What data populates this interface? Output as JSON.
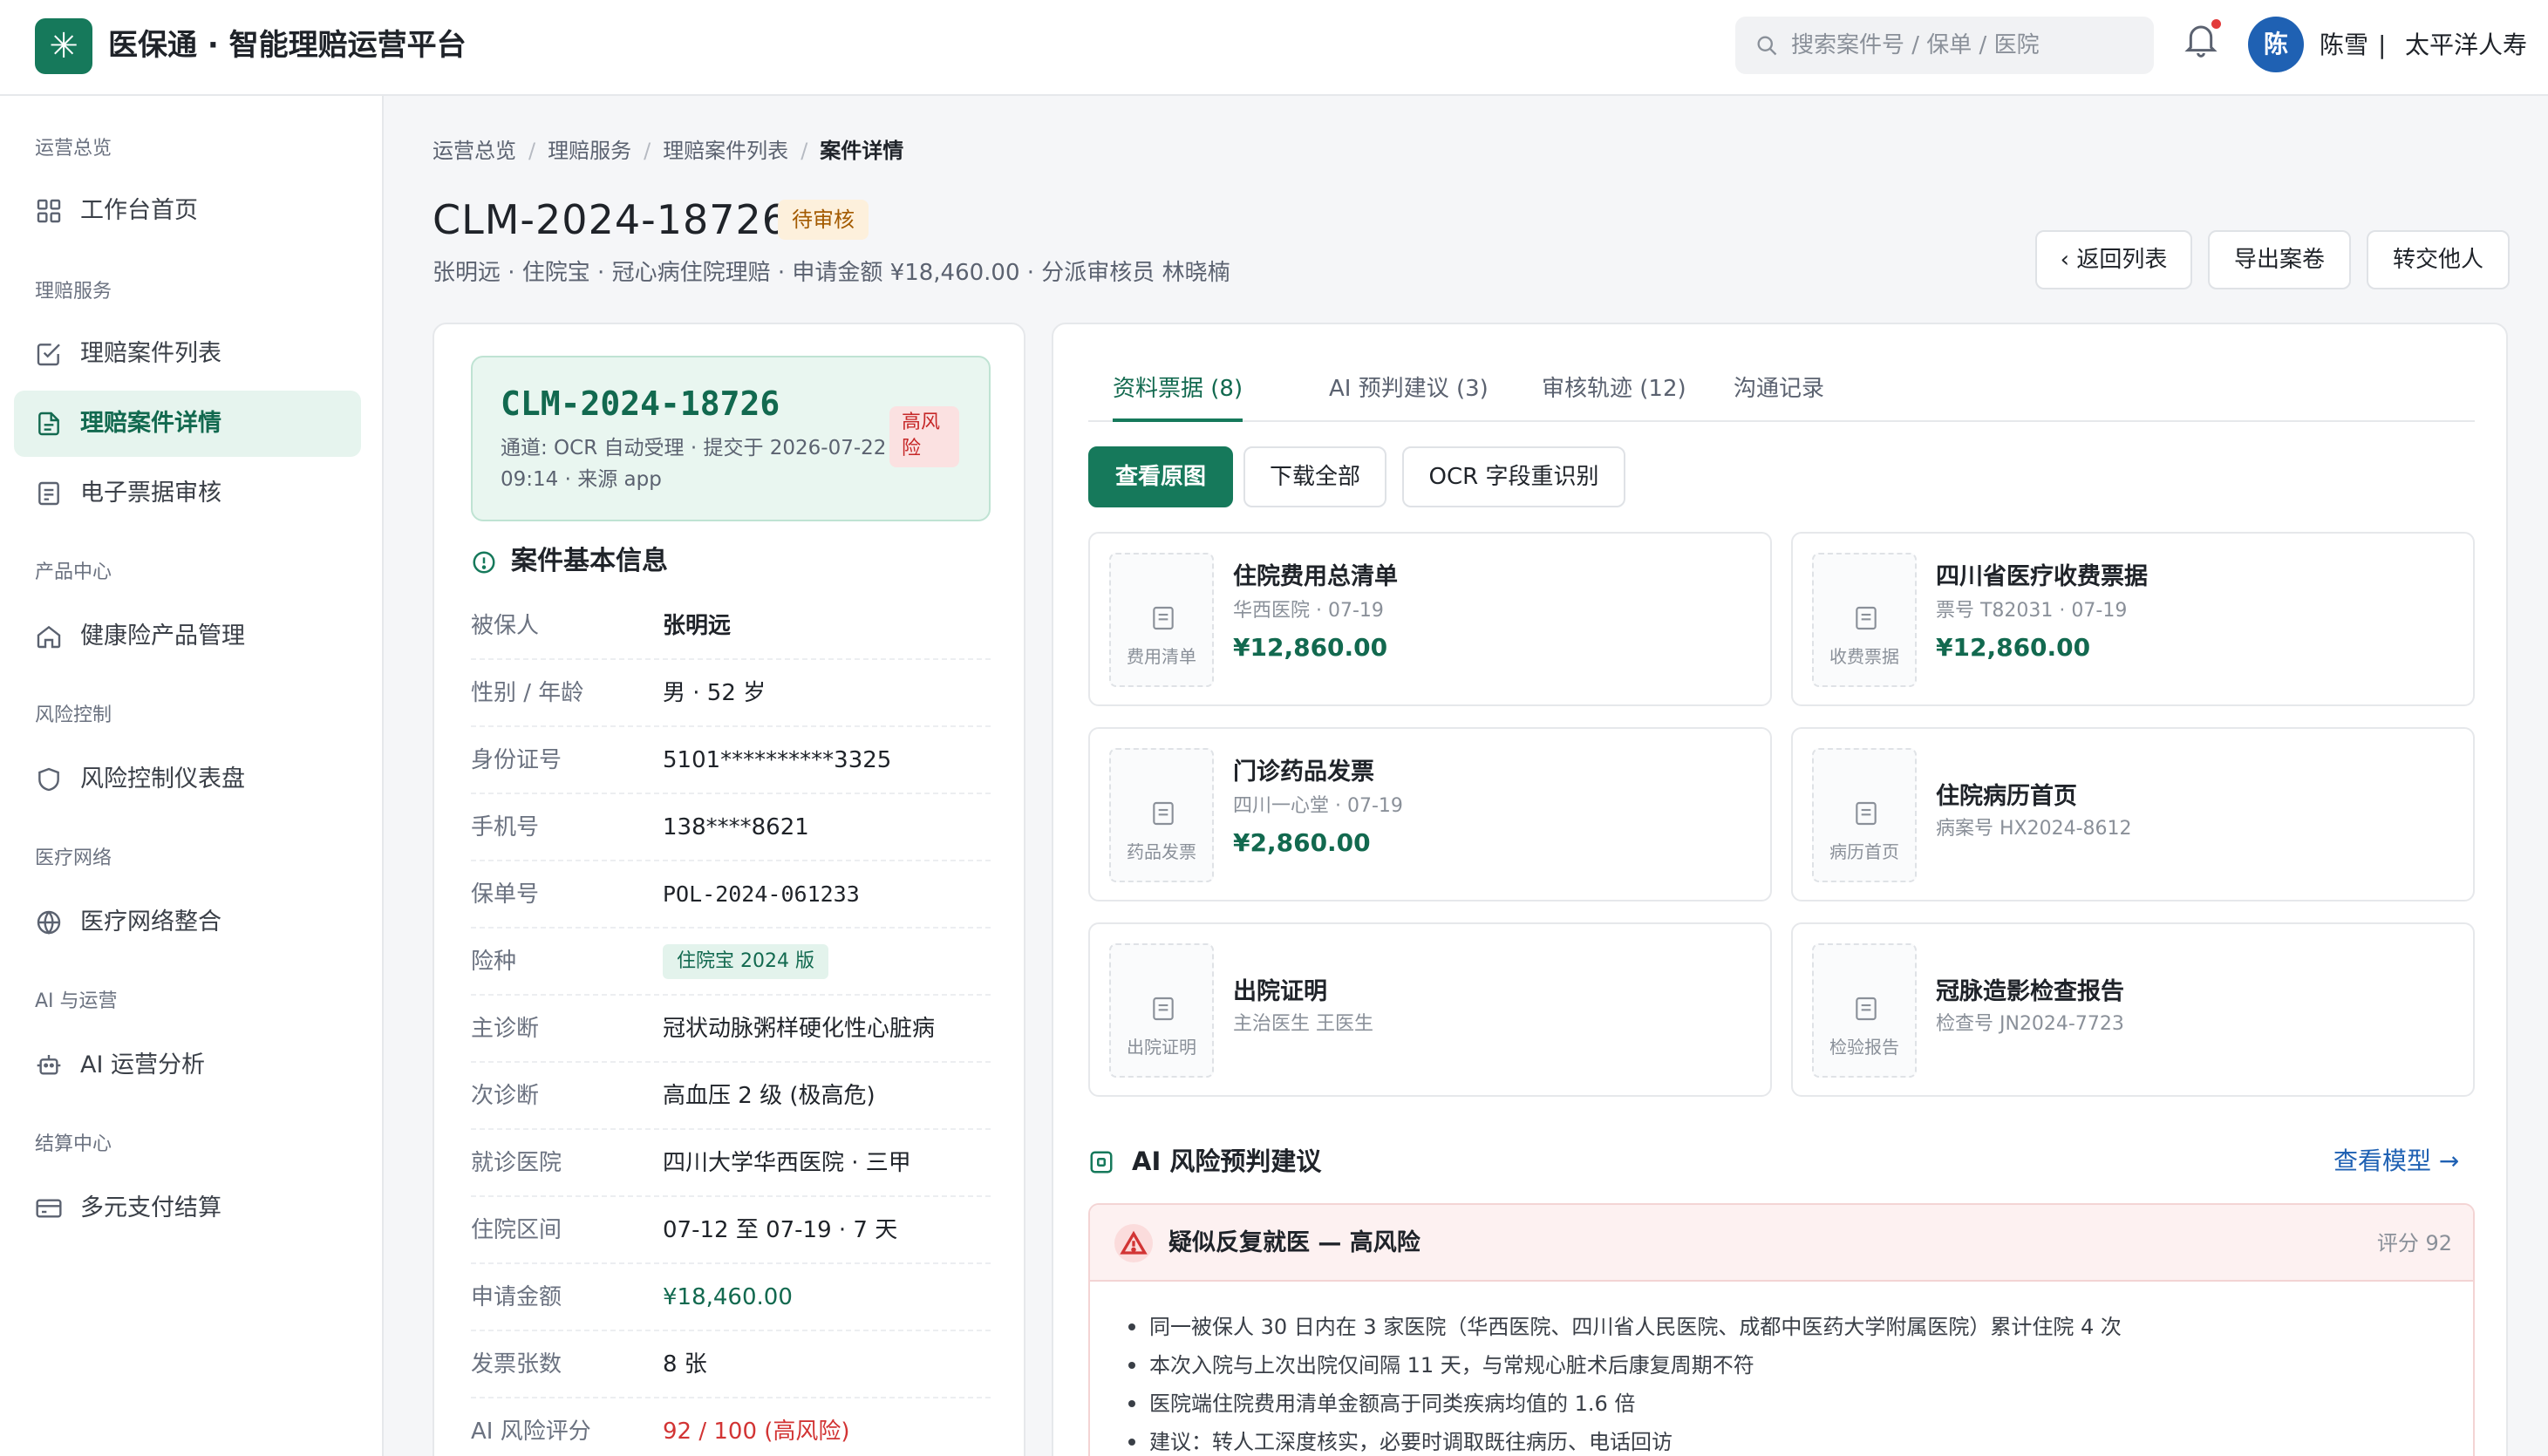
{
  "app": {
    "logo_glyph": "✳",
    "title": "医保通 · 智能理赔运营平台"
  },
  "header": {
    "search_placeholder": "搜索案件号 / 保单 / 医院",
    "avatar_initial": "陈",
    "user_name": "陈雪",
    "separator": "|",
    "org_name": "太平洋人寿"
  },
  "sidebar": {
    "groups": [
      {
        "title": "运营总览",
        "items": [
          {
            "label": "工作台首页",
            "icon": "dashboard-icon"
          }
        ]
      },
      {
        "title": "理赔服务",
        "items": [
          {
            "label": "理赔案件列表",
            "icon": "checklist-icon"
          },
          {
            "label": "理赔案件详情",
            "icon": "document-icon",
            "active": true
          },
          {
            "label": "电子票据审核",
            "icon": "receipt-icon"
          }
        ]
      },
      {
        "title": "产品中心",
        "items": [
          {
            "label": "健康险产品管理",
            "icon": "home-icon"
          }
        ]
      },
      {
        "title": "风险控制",
        "items": [
          {
            "label": "风险控制仪表盘",
            "icon": "shield-icon"
          }
        ]
      },
      {
        "title": "医疗网络",
        "items": [
          {
            "label": "医疗网络整合",
            "icon": "globe-icon"
          }
        ]
      },
      {
        "title": "AI 与运营",
        "items": [
          {
            "label": "AI 运营分析",
            "icon": "robot-icon"
          }
        ]
      },
      {
        "title": "结算中心",
        "items": [
          {
            "label": "多元支付结算",
            "icon": "card-icon"
          }
        ]
      }
    ]
  },
  "breadcrumb": [
    "运营总览",
    "理赔服务",
    "理赔案件列表",
    "案件详情"
  ],
  "breadcrumb_sep": "/",
  "case": {
    "id": "CLM-2024-18726",
    "status": "待审核",
    "subtitle": "张明远 · 住院宝 · 冠心病住院理赔 · 申请金额 ¥18,460.00 · 分派审核员 林晓楠",
    "actions": {
      "back": "‹ 返回列表",
      "export": "导出案卷",
      "transfer": "转交他人"
    }
  },
  "case_box": {
    "id": "CLM-2024-18726",
    "meta": "通道: OCR 自动受理 · 提交于 2026-07-22 09:14 · 来源 app",
    "risk": "高风险"
  },
  "basic_info": {
    "title": "案件基本信息",
    "rows": [
      {
        "key": "被保人",
        "value": "张明远"
      },
      {
        "key": "性别 / 年龄",
        "value": "男 · 52 岁"
      },
      {
        "key": "身份证号",
        "value": "5101**********3325"
      },
      {
        "key": "手机号",
        "value": "138****8621"
      },
      {
        "key": "保单号",
        "value": "POL-2024-061233"
      },
      {
        "key": "险种",
        "value": "住院宝 2024 版"
      },
      {
        "key": "主诊断",
        "value": "冠状动脉粥样硬化性心脏病"
      },
      {
        "key": "次诊断",
        "value": "高血压 2 级 (极高危)"
      },
      {
        "key": "就诊医院",
        "value": "四川大学华西医院 · 三甲"
      },
      {
        "key": "住院区间",
        "value": "07-12 至 07-19 · 7 天"
      },
      {
        "key": "申请金额",
        "value": "¥18,460.00"
      },
      {
        "key": "发票张数",
        "value": "8 张"
      },
      {
        "key": "AI 风险评分",
        "value": "92 / 100 (高风险)"
      }
    ]
  },
  "tabs": [
    "资料票据 (8)",
    "AI 预判建议 (3)",
    "审核轨迹 (12)",
    "沟通记录"
  ],
  "doc_actions": {
    "view": "查看原图",
    "download": "下载全部",
    "reocr": "OCR 字段重识别"
  },
  "documents": [
    {
      "thumb": "费用清单",
      "title": "住院费用总清单",
      "meta": "华西医院 · 07-19",
      "amount": "¥12,860.00"
    },
    {
      "thumb": "收费票据",
      "title": "四川省医疗收费票据",
      "meta": "票号 T82031 · 07-19",
      "amount": "¥12,860.00"
    },
    {
      "thumb": "药品发票",
      "title": "门诊药品发票",
      "meta": "四川一心堂 · 07-19",
      "amount": "¥2,860.00"
    },
    {
      "thumb": "病历首页",
      "title": "住院病历首页",
      "meta": "病案号 HX2024-8612",
      "amount": ""
    },
    {
      "thumb": "出院证明",
      "title": "出院证明",
      "meta": "主治医生 王医生",
      "amount": ""
    },
    {
      "thumb": "检验报告",
      "title": "冠脉造影检查报告",
      "meta": "检查号 JN2024-7723",
      "amount": ""
    }
  ],
  "ai": {
    "title": "AI 风险预判建议",
    "link": "查看模型 →",
    "alert_title": "疑似反复就医 — 高风险",
    "score": "评分 92",
    "bullets": [
      "同一被保人 30 日内在 3 家医院（华西医院、四川省人民医院、成都中医药大学附属医院）累计住院 4 次",
      "本次入院与上次出院仅间隔 11 天，与常规心脏术后康复周期不符",
      "医院端住院费用清单金额高于同类疾病均值的 1.6 倍",
      "建议：转人工深度核实，必要时调取既往病历、电话回访"
    ]
  },
  "colors": {
    "brand": "#16795b",
    "danger": "#d23434",
    "link": "#1f61b3",
    "warning": "#a35a00"
  }
}
